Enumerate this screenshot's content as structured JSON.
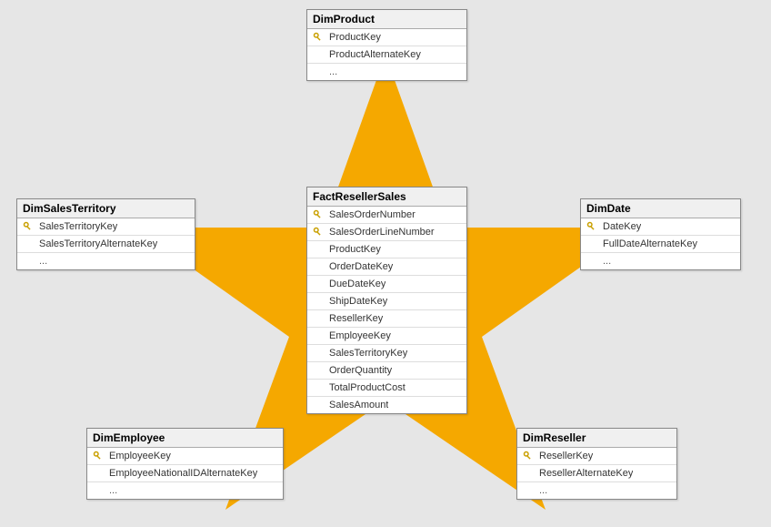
{
  "star_color": "#f5a800",
  "key_icon_name": "key-icon",
  "tables": {
    "dimProduct": {
      "title": "DimProduct",
      "rows": [
        {
          "name": "ProductKey",
          "pk": true
        },
        {
          "name": "ProductAlternateKey",
          "pk": false
        }
      ],
      "more": "..."
    },
    "dimSalesTerritory": {
      "title": "DimSalesTerritory",
      "rows": [
        {
          "name": "SalesTerritoryKey",
          "pk": true
        },
        {
          "name": "SalesTerritoryAlternateKey",
          "pk": false
        }
      ],
      "more": "..."
    },
    "dimDate": {
      "title": "DimDate",
      "rows": [
        {
          "name": "DateKey",
          "pk": true
        },
        {
          "name": "FullDateAlternateKey",
          "pk": false
        }
      ],
      "more": "..."
    },
    "dimEmployee": {
      "title": "DimEmployee",
      "rows": [
        {
          "name": "EmployeeKey",
          "pk": true
        },
        {
          "name": "EmployeeNationalIDAlternateKey",
          "pk": false
        }
      ],
      "more": "..."
    },
    "dimReseller": {
      "title": "DimReseller",
      "rows": [
        {
          "name": "ResellerKey",
          "pk": true
        },
        {
          "name": "ResellerAlternateKey",
          "pk": false
        }
      ],
      "more": "..."
    },
    "factResellerSales": {
      "title": "FactResellerSales",
      "rows": [
        {
          "name": "SalesOrderNumber",
          "pk": true
        },
        {
          "name": "SalesOrderLineNumber",
          "pk": true
        },
        {
          "name": "ProductKey",
          "pk": false
        },
        {
          "name": "OrderDateKey",
          "pk": false
        },
        {
          "name": "DueDateKey",
          "pk": false
        },
        {
          "name": "ShipDateKey",
          "pk": false
        },
        {
          "name": "ResellerKey",
          "pk": false
        },
        {
          "name": "EmployeeKey",
          "pk": false
        },
        {
          "name": "SalesTerritoryKey",
          "pk": false
        },
        {
          "name": "OrderQuantity",
          "pk": false
        },
        {
          "name": "TotalProductCost",
          "pk": false
        },
        {
          "name": "SalesAmount",
          "pk": false
        }
      ]
    }
  }
}
